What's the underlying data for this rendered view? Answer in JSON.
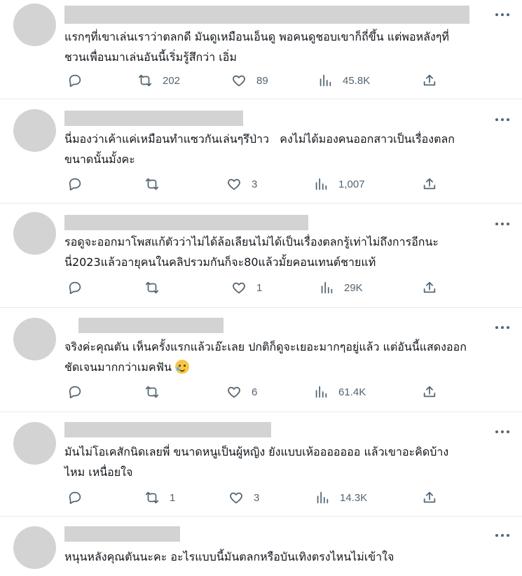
{
  "tweets": [
    {
      "text": "แรกๆที่เขาเล่นเราว่าตลกดี มันดูเหมือนเอ็นดู พอคนดูชอบเขาก็ถี่ขึ้น แต่พอหลังๆที่\nชวนเพื่อนมาเล่นอันนี้เริ่มรู้สึกว่า เอิ่ม",
      "retweets": "202",
      "likes": "89",
      "views": "45.8K"
    },
    {
      "text": "นี่มองว่าเค้าแค่เหมือนทำแซวกันเล่นๆรึป่าว   คงไม่ได้มองคนออกสาวเป็นเรื่องตลก\nขนาดนั้นมั้งคะ",
      "retweets": "",
      "likes": "3",
      "views": "1,007"
    },
    {
      "text": "รอดูจะออกมาโพสแก้ตัวว่าไม่ได้ล้อเลียนไม่ได้เป็นเรื่องตลกรู้เท่าไม่ถึงการอีกนะ\nนี่2023แล้วอายุคนในคลิปรวมกันก็จะ80แล้วมั้ยคอนเทนต์ชายแท้",
      "retweets": "",
      "likes": "1",
      "views": "29K"
    },
    {
      "text": "จริงค่ะคุณตัน เห็นครั้งแรกแล้วเอ๊ะเลย ปกติก็ดูจะเยอะมากๆอยู่แล้ว แต่อันนี้แสดงออก\nชัดเจนมากกว่าเมคฟัน",
      "retweets": "",
      "likes": "6",
      "views": "61.4K",
      "emoji": "face-holding-back-tears-emoji"
    },
    {
      "text": "มันไม่โอเคสักนิดเลยพี่ ขนาดหนูเป็นผู้หญิง ยังแบบเห้อออออออ แล้วเขาอะคิดบ้าง\nไหม เหนื่อยใจ",
      "retweets": "1",
      "likes": "3",
      "views": "14.3K"
    },
    {
      "text": "หนุนหลังคุณตันนะคะ อะไรแบบนี้มันตลกหรือบันเทิงตรงไหนไม่เข้าใจ",
      "retweets": "",
      "likes": "",
      "views": ""
    }
  ],
  "colors": {
    "text": "#0f1419",
    "muted": "#536471",
    "placeholder": "#d3d3d3",
    "divider": "#e6e9ec"
  },
  "icons": [
    "reply-icon",
    "retweet-icon",
    "like-icon",
    "views-icon",
    "share-icon",
    "more-icon"
  ]
}
